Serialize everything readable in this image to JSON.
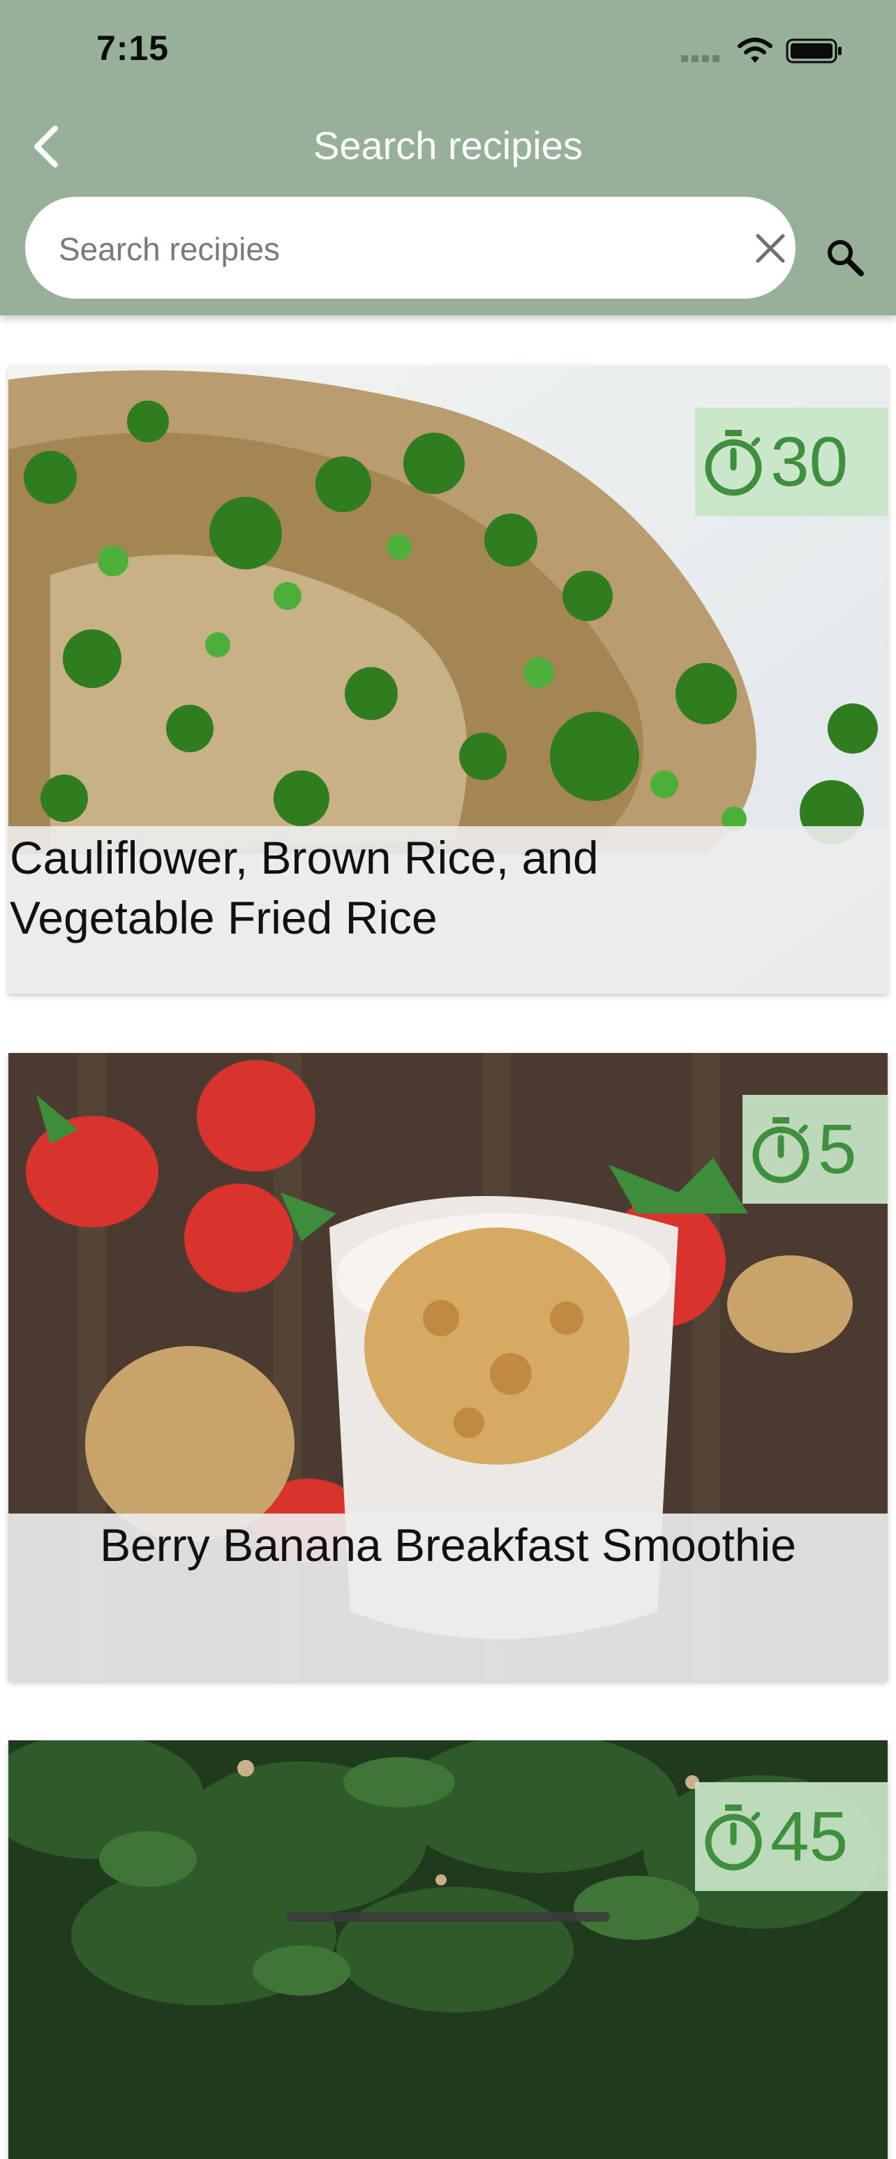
{
  "status_bar": {
    "time": "7:15"
  },
  "header": {
    "title": "Search recipies"
  },
  "search": {
    "placeholder": "Search recipies",
    "value": ""
  },
  "recipes": [
    {
      "title": "Cauliflower, Brown Rice, and Vegetable Fried Rice",
      "minutes": "30"
    },
    {
      "title": "Berry Banana Breakfast Smoothie",
      "minutes": "5"
    },
    {
      "title": "",
      "minutes": "45"
    }
  ],
  "colors": {
    "app_bar": "#98b09a",
    "badge_text": "#3f8f3f",
    "badge_bg": "#c8e6c8"
  }
}
